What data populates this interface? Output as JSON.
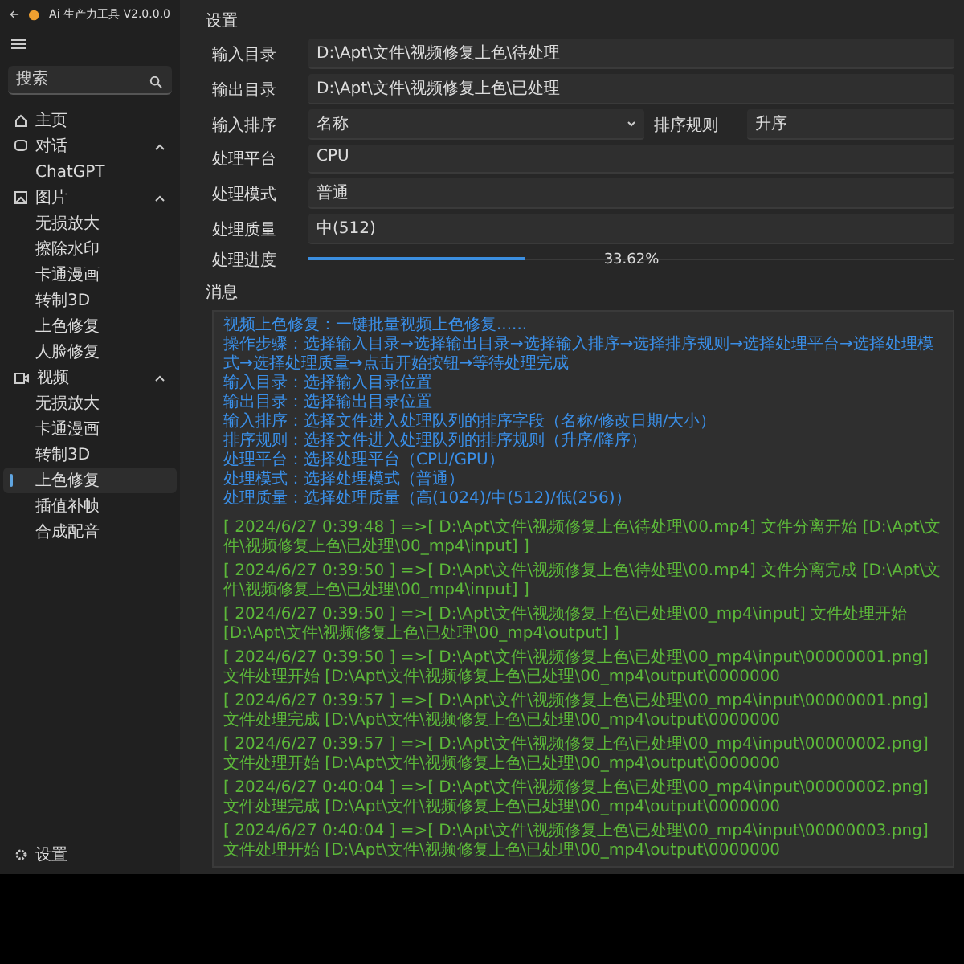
{
  "window": {
    "title": "Ai 生产力工具 V2.0.0.0"
  },
  "sidebar": {
    "search": {
      "placeholder": "搜索"
    },
    "items": [
      {
        "label": "主页",
        "selected": false
      },
      {
        "label": "对话",
        "expanded": true,
        "children": [
          {
            "label": "ChatGPT",
            "selected": false
          }
        ]
      },
      {
        "label": "图片",
        "expanded": true,
        "children": [
          {
            "label": "无损放大",
            "selected": false
          },
          {
            "label": "擦除水印",
            "selected": false
          },
          {
            "label": "卡通漫画",
            "selected": false
          },
          {
            "label": "转制3D",
            "selected": false
          },
          {
            "label": "上色修复",
            "selected": false
          },
          {
            "label": "人脸修复",
            "selected": false
          }
        ]
      },
      {
        "label": "视频",
        "expanded": true,
        "children": [
          {
            "label": "无损放大",
            "selected": false
          },
          {
            "label": "卡通漫画",
            "selected": false
          },
          {
            "label": "转制3D",
            "selected": false
          },
          {
            "label": "上色修复",
            "selected": true
          },
          {
            "label": "插值补帧",
            "selected": false
          },
          {
            "label": "合成配音",
            "selected": false
          }
        ]
      }
    ],
    "footer": {
      "label": "设置"
    }
  },
  "settings": {
    "title": "设置",
    "rows": [
      {
        "kind": "field",
        "label": "输入目录",
        "value": "D:\\Apt\\文件\\视频修复上色\\待处理"
      },
      {
        "kind": "field",
        "label": "输出目录",
        "value": "D:\\Apt\\文件\\视频修复上色\\已处理"
      },
      {
        "kind": "sort",
        "label": "输入排序",
        "value": "名称",
        "rule_label": "排序规则",
        "rule_value": "升序"
      },
      {
        "kind": "field",
        "label": "处理平台",
        "value": "CPU"
      },
      {
        "kind": "field",
        "label": "处理模式",
        "value": "普通"
      },
      {
        "kind": "field",
        "label": "处理质量",
        "value": "中(512)"
      },
      {
        "kind": "progress",
        "label": "处理进度",
        "level": 0.3362,
        "reading": "33.62%"
      }
    ]
  },
  "messages": {
    "title": "消息",
    "info": [
      "视频上色修复：一键批量视频上色修复......",
      "操作步骤：选择输入目录→选择输出目录→选择输入排序→选择排序规则→选择处理平台→选择处理模式→选择处理质量→点击开始按钮→等待处理完成",
      "输入目录：选择输入目录位置",
      "输出目录：选择输出目录位置",
      "输入排序：选择文件进入处理队列的排序字段（名称/修改日期/大小）",
      "排序规则：选择文件进入处理队列的排序规则（升序/降序）",
      "处理平台：选择处理平台（CPU/GPU）",
      "处理模式：选择处理模式（普通）",
      "处理质量：选择处理质量（高(1024)/中(512)/低(256)）"
    ],
    "log": [
      "[ 2024/6/27 0:39:48 ] =>[ D:\\Apt\\文件\\视频修复上色\\待处理\\00.mp4] 文件分离开始 [D:\\Apt\\文件\\视频修复上色\\已处理\\00_mp4\\input] ]",
      "[ 2024/6/27 0:39:50 ] =>[ D:\\Apt\\文件\\视频修复上色\\待处理\\00.mp4] 文件分离完成 [D:\\Apt\\文件\\视频修复上色\\已处理\\00_mp4\\input] ]",
      "[ 2024/6/27 0:39:50 ] =>[ D:\\Apt\\文件\\视频修复上色\\已处理\\00_mp4\\input] 文件处理开始 [D:\\Apt\\文件\\视频修复上色\\已处理\\00_mp4\\output] ]",
      "[ 2024/6/27 0:39:50 ] =>[ D:\\Apt\\文件\\视频修复上色\\已处理\\00_mp4\\input\\00000001.png] 文件处理开始 [D:\\Apt\\文件\\视频修复上色\\已处理\\00_mp4\\output\\0000000",
      "[ 2024/6/27 0:39:57 ] =>[ D:\\Apt\\文件\\视频修复上色\\已处理\\00_mp4\\input\\00000001.png] 文件处理完成 [D:\\Apt\\文件\\视频修复上色\\已处理\\00_mp4\\output\\0000000",
      "[ 2024/6/27 0:39:57 ] =>[ D:\\Apt\\文件\\视频修复上色\\已处理\\00_mp4\\input\\00000002.png] 文件处理开始 [D:\\Apt\\文件\\视频修复上色\\已处理\\00_mp4\\output\\0000000",
      "[ 2024/6/27 0:40:04 ] =>[ D:\\Apt\\文件\\视频修复上色\\已处理\\00_mp4\\input\\00000002.png] 文件处理完成 [D:\\Apt\\文件\\视频修复上色\\已处理\\00_mp4\\output\\0000000",
      "[ 2024/6/27 0:40:04 ] =>[ D:\\Apt\\文件\\视频修复上色\\已处理\\00_mp4\\input\\00000003.png] 文件处理开始 [D:\\Apt\\文件\\视频修复上色\\已处理\\00_mp4\\output\\0000000"
    ]
  }
}
